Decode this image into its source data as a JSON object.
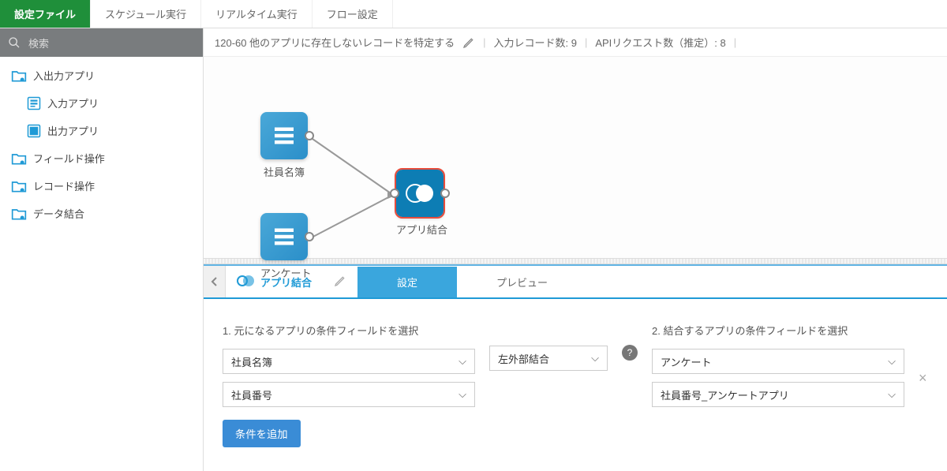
{
  "topTabs": {
    "t0": "設定ファイル",
    "t1": "スケジュール実行",
    "t2": "リアルタイム実行",
    "t3": "フロー設定"
  },
  "search": {
    "placeholder": "検索"
  },
  "tree": {
    "ioApps": "入出力アプリ",
    "inputApp": "入力アプリ",
    "outputApp": "出力アプリ",
    "fieldOps": "フィールド操作",
    "recordOps": "レコード操作",
    "dataJoin": "データ結合"
  },
  "breadcrumb": {
    "title": "120-60 他のアプリに存在しないレコードを特定する",
    "inputRecords": "入力レコード数: 9",
    "apiRequests": "APIリクエスト数（推定）: 8"
  },
  "nodes": {
    "n1": "社員名簿",
    "n2": "アンケート",
    "n3": "アプリ結合"
  },
  "panel": {
    "title": "アプリ結合",
    "tabSettings": "設定",
    "tabPreview": "プレビュー",
    "label1": "1. 元になるアプリの条件フィールドを選択",
    "label2": "2. 結合するアプリの条件フィールドを選択",
    "select1a": "社員名簿",
    "select1b": "社員番号",
    "joinType": "左外部結合",
    "select2a": "アンケート",
    "select2b": "社員番号_アンケートアプリ",
    "addCondition": "条件を追加"
  }
}
